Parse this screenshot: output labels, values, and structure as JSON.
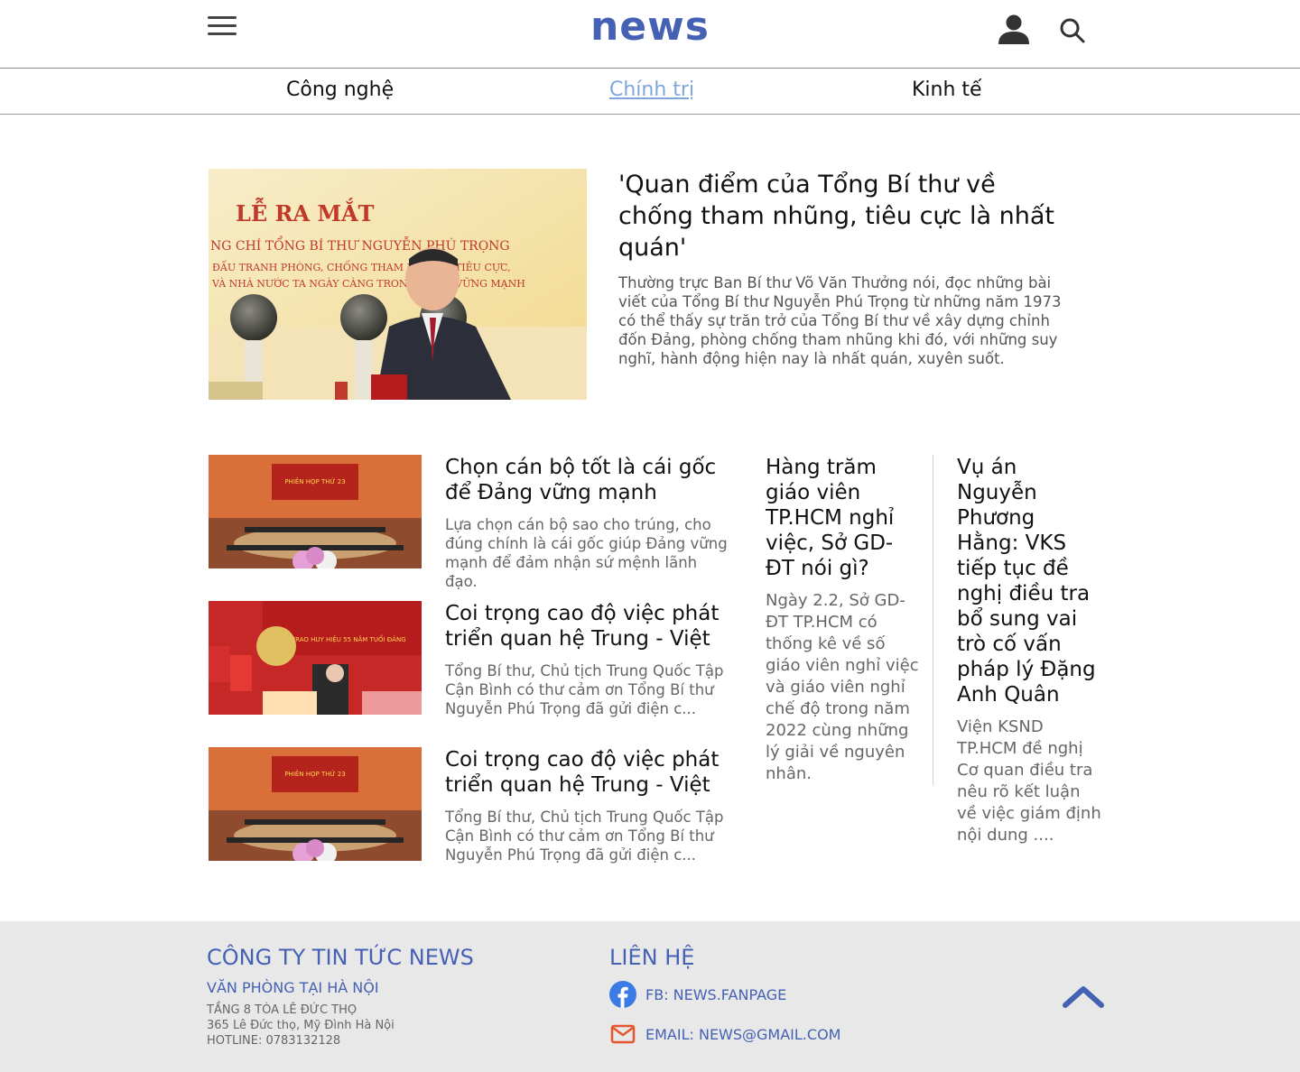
{
  "header": {
    "logo": "news"
  },
  "nav": {
    "items": [
      "Công nghệ",
      "Chính trị",
      "Kinh tế"
    ],
    "active": "Chính trị"
  },
  "featured": {
    "title": "'Quan điểm của Tổng Bí thư về chống tham nhũng, tiêu cực là nhất quán'",
    "description": "Thường trực Ban Bí thư Võ Văn Thưởng nói, đọc những bài viết của Tổng Bí thư Nguyễn Phú Trọng từ những năm 1973 có thể thấy sự trăn trở của Tổng Bí thư về xây dựng chỉnh đốn Đảng, phòng chống tham nhũng khi đó, với những suy nghĩ, hành động hiện nay là nhất quán, xuyên suốt.",
    "image_text": {
      "banner": "LỄ RA MẮT",
      "sub1": "NG CHÍ TỔNG BÍ THƯ NGUYỄN PHÚ TRỌNG",
      "sub2": "ĐẤU TRANH PHÒNG, CHỐNG THAM NHŨNG, TIÊU CỰC,",
      "sub3": "VÀ NHÀ NƯỚC TA NGÀY CÀNG TRONG SẠCH, VỮNG MẠNH"
    }
  },
  "list": [
    {
      "title": "Chọn cán bộ tốt là cái gốc để Đảng vững mạnh",
      "description": "Lựa chọn cán bộ sao cho trúng, cho đúng chính là cái gốc giúp Đảng vững mạnh để đảm nhận sứ mệnh lãnh đạo.",
      "image_banner": "PHIÊN HỌP THỨ 23"
    },
    {
      "title": "Coi trọng cao độ việc phát triển quan hệ Trung - Việt",
      "description": "Tổng Bí thư, Chủ tịch Trung Quốc Tập Cận Bình có thư cảm ơn Tổng Bí thư Nguyễn Phú Trọng đã gửi điện c...",
      "image_banner": "LỄ TRAO HUY HIỆU 55 NĂM TUỔI ĐẢNG"
    },
    {
      "title": "Coi trọng cao độ việc phát triển quan hệ Trung - Việt",
      "description": "Tổng Bí thư, Chủ tịch Trung Quốc Tập Cận Bình có thư cảm ơn Tổng Bí thư Nguyễn Phú Trọng đã gửi điện c...",
      "image_banner": "PHIÊN HỌP THỨ 23"
    }
  ],
  "columns": [
    {
      "title": "Hàng trăm giáo viên TP.HCM nghỉ việc, Sở GD-ĐT nói gì?",
      "description": "Ngày 2.2, Sở GD-ĐT TP.HCM có thống kê về số giáo viên nghỉ việc và giáo viên nghỉ chế độ trong năm 2022 cùng những lý giải về nguyên nhân."
    },
    {
      "title": "Vụ án Nguyễn Phương Hằng: VKS tiếp tục đề nghị điều tra bổ sung vai trò cố vấn pháp lý Đặng Anh Quân",
      "description": "Viện KSND TP.HCM đề nghị Cơ quan điều tra nêu rõ kết luận về việc giám định nội dung ...."
    }
  ],
  "footer": {
    "company": "CÔNG TY TIN TỨC NEWS",
    "office": "VĂN PHÒNG TẠI HÀ NỘI",
    "lines": [
      "TẦNG 8 TÒA LÊ ĐỨC THỌ",
      "365 Lê Đức thọ, Mỹ Đình Hà Nội",
      "HOTLINE: 0783132128"
    ],
    "contact_heading": "LIÊN HỆ",
    "fb": "FB: NEWS.FANPAGE",
    "email": "EMAIL: NEWS@GMAIL.COM"
  },
  "colors": {
    "brand": "#4561b3",
    "active_nav": "#7fa6d8",
    "footer_bg": "#e8e8e8",
    "facebook": "#3b7be6",
    "email_icon": "#e8552c"
  },
  "icons": [
    "hamburger-menu-icon",
    "user-icon",
    "search-icon",
    "facebook-icon",
    "mail-icon",
    "chevron-up-icon"
  ]
}
